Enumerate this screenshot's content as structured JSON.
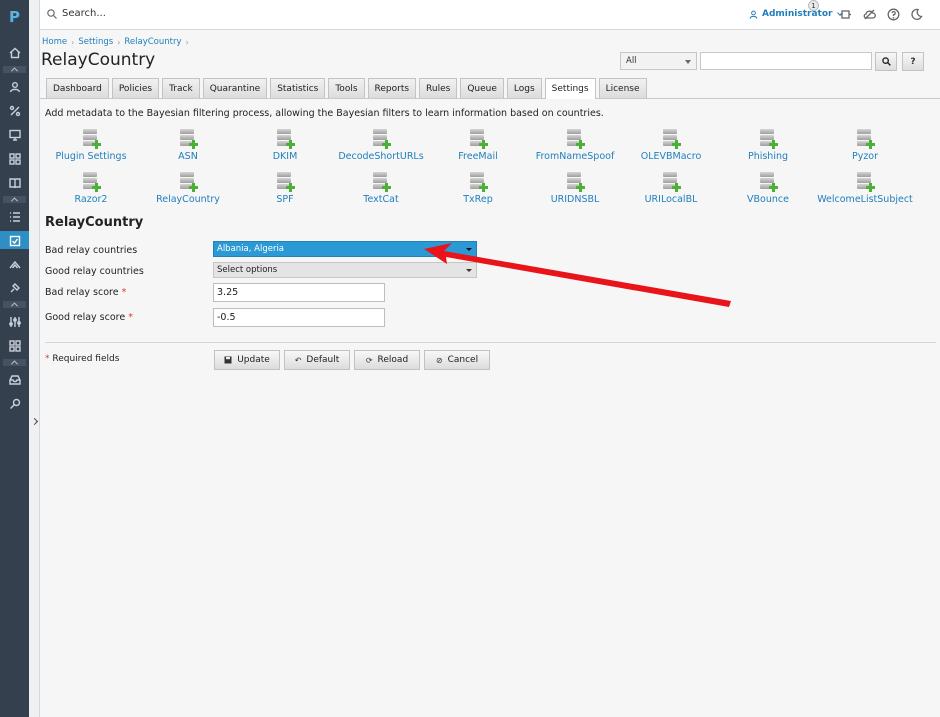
{
  "rail": {
    "logo": "P",
    "icons": [
      "dashboard-icon",
      "user-icon",
      "percent-icon",
      "monitor-icon",
      "apps-icon",
      "book-icon",
      "list-icon",
      "mail-filter-icon",
      "network-icon",
      "plugin-icon",
      "sliders-icon",
      "modules-icon",
      "inbox-icon",
      "tools-icon"
    ]
  },
  "topbar": {
    "search_placeholder": "Search...",
    "user_label": "Administrator",
    "notification_count": "1"
  },
  "breadcrumb": [
    "Home",
    "Settings",
    "RelayCountry"
  ],
  "page_title": "RelayCountry",
  "filter": {
    "select_value": "All",
    "input_value": "",
    "search_button": "⌕",
    "help_button": "?"
  },
  "tabs": [
    "Dashboard",
    "Policies",
    "Track",
    "Quarantine",
    "Statistics",
    "Tools",
    "Reports",
    "Rules",
    "Queue",
    "Logs",
    "Settings",
    "License"
  ],
  "active_tab": "Settings",
  "description": "Add metadata to the Bayesian filtering process, allowing the Bayesian filters to learn information based on countries.",
  "plugins": [
    "Plugin Settings",
    "ASN",
    "DKIM",
    "DecodeShortURLs",
    "FreeMail",
    "FromNameSpoof",
    "OLEVBMacro",
    "Phishing",
    "Pyzor",
    "Razor2",
    "RelayCountry",
    "SPF",
    "TextCat",
    "TxRep",
    "URIDNSBL",
    "URILocalBL",
    "VBounce",
    "WelcomeListSubject"
  ],
  "form": {
    "title": "RelayCountry",
    "bad_relay_countries_label": "Bad relay countries",
    "bad_relay_countries_value": "Albania, Algeria",
    "good_relay_countries_label": "Good relay countries",
    "good_relay_countries_value": "Select options",
    "bad_relay_score_label": "Bad relay score",
    "bad_relay_score_value": "3.25",
    "good_relay_score_label": "Good relay score",
    "good_relay_score_value": "-0.5",
    "required_mark": "*",
    "required_note": "Required fields"
  },
  "buttons": {
    "update": "Update",
    "default": "Default",
    "reload": "Reload",
    "cancel": "Cancel"
  },
  "colors": {
    "accent": "#2b99d4",
    "link": "#1f7fbd",
    "rail": "#34404d",
    "annotation_arrow": "#e8141a"
  }
}
